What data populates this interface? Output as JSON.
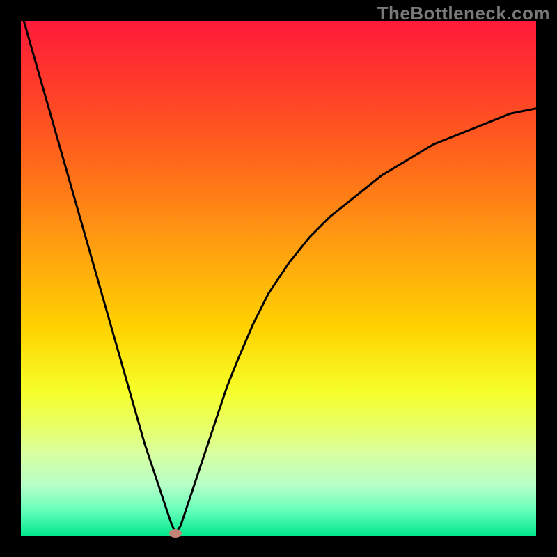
{
  "attribution": "TheBottleneck.com",
  "chart_data": {
    "type": "line",
    "title": "",
    "xlabel": "",
    "ylabel": "",
    "xlim": [
      0,
      100
    ],
    "ylim": [
      0,
      100
    ],
    "x": [
      0,
      2,
      4,
      6,
      8,
      10,
      12,
      14,
      16,
      18,
      20,
      22,
      24,
      26,
      28,
      29,
      30,
      31,
      32,
      34,
      36,
      38,
      40,
      42,
      45,
      48,
      52,
      56,
      60,
      65,
      70,
      75,
      80,
      85,
      90,
      95,
      100
    ],
    "values": [
      102,
      95,
      88,
      81,
      74,
      67,
      60,
      53,
      46,
      39,
      32,
      25,
      18,
      12,
      6,
      3,
      0.5,
      2,
      5,
      11,
      17,
      23,
      29,
      34,
      41,
      47,
      53,
      58,
      62,
      66,
      70,
      73,
      76,
      78,
      80,
      82,
      83
    ],
    "marker": {
      "x": 30,
      "y": 0.5
    },
    "grid": false,
    "legend": false
  },
  "colors": {
    "frame": "#000000",
    "curve": "#000000",
    "marker": "#c58277"
  }
}
